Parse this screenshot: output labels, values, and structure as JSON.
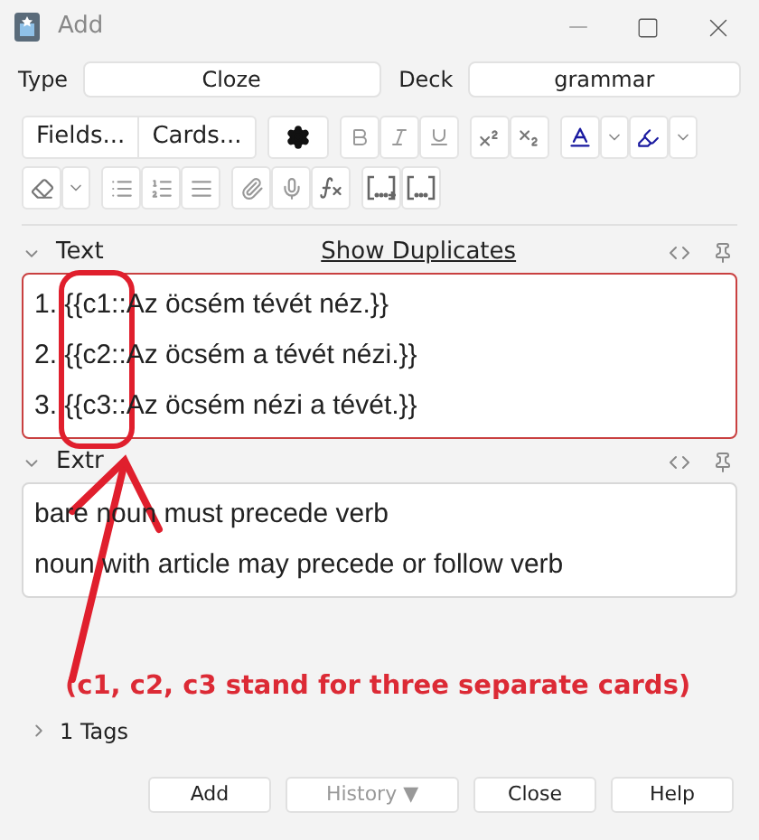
{
  "window": {
    "title": "Add"
  },
  "type": {
    "label": "Type",
    "value": "Cloze"
  },
  "deck": {
    "label": "Deck",
    "value": "grammar"
  },
  "toolbar": {
    "buttons": [
      {
        "label": "Fields..."
      },
      {
        "label": "Cards..."
      }
    ]
  },
  "fields": [
    {
      "name": "Text",
      "expanded": true,
      "duplicate": true,
      "link": "Show Duplicates",
      "lines": [
        "1. {{c1::Az öcsém tévét néz.}}",
        "2. {{c2::Az öcsém a tévét nézi.}}",
        "3. {{c3::Az öcsém nézi a tévét.}}"
      ]
    },
    {
      "name": "Extr",
      "expanded": true,
      "duplicate": false,
      "lines": [
        "bare noun must precede verb",
        "noun with article may precede or follow verb"
      ]
    }
  ],
  "annotation": {
    "caption": "(c1, c2, c3 stand for three separate cards)"
  },
  "tags": {
    "label": "1 Tags",
    "expanded": false
  },
  "buttons": [
    {
      "label": "Add",
      "disabled": false
    },
    {
      "label": "History ▼",
      "disabled": true
    },
    {
      "label": "Close",
      "disabled": false
    },
    {
      "label": "Help",
      "disabled": false
    }
  ]
}
